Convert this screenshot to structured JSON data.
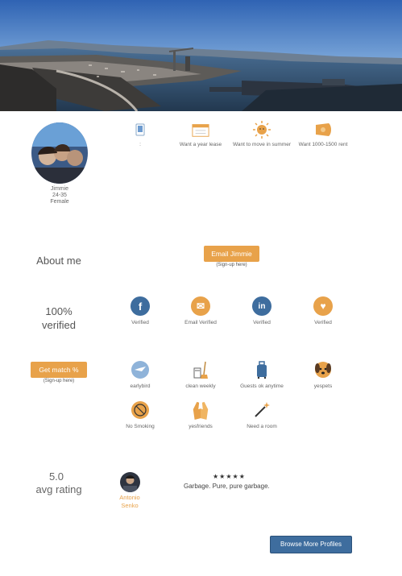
{
  "profile": {
    "name": "Jimmie",
    "age_range": "24-35",
    "gender": "Female"
  },
  "preferences": [
    {
      "icon": "phone-icon",
      "label": ":"
    },
    {
      "icon": "calendar-icon",
      "label": "Want a year lease"
    },
    {
      "icon": "sun-icon",
      "label": "Want to move in summer"
    },
    {
      "icon": "money-icon",
      "label": "Want 1000-1500 rent"
    }
  ],
  "about": {
    "heading": "About me",
    "email_button": "Email Jimmie",
    "signup_note": "(Sign-up here)"
  },
  "verification": {
    "heading_line1": "100%",
    "heading_line2": "verified",
    "badges": [
      {
        "icon": "facebook-icon",
        "label": "Verified",
        "color": "#3e6d9e",
        "glyph": "f"
      },
      {
        "icon": "email-icon",
        "label": "Email Verified",
        "color": "#e8a24a",
        "glyph": "✉"
      },
      {
        "icon": "linkedin-icon",
        "label": "Verified",
        "color": "#3e6d9e",
        "glyph": "in"
      },
      {
        "icon": "heart-icon",
        "label": "Verified",
        "color": "#e8a24a",
        "glyph": "♥"
      }
    ]
  },
  "match": {
    "button": "Get match %",
    "signup_note": "(Sign-up here)"
  },
  "traits": [
    {
      "icon": "bird-icon",
      "label": "earlybird"
    },
    {
      "icon": "broom-icon",
      "label": "clean weekly"
    },
    {
      "icon": "luggage-icon",
      "label": "Guests ok anytime"
    },
    {
      "icon": "dog-icon",
      "label": "yespets"
    },
    {
      "icon": "no-smoking-icon",
      "label": "No Smoking"
    },
    {
      "icon": "high-five-icon",
      "label": "yesfriends"
    },
    {
      "icon": "magic-wand-icon",
      "label": "Need a room"
    }
  ],
  "rating": {
    "score": "5.0",
    "label": "avg rating",
    "reviewer_first": "Antonio",
    "reviewer_last": "Senko",
    "stars": "★★★★★",
    "review": "Garbage. Pure, pure garbage."
  },
  "footer": {
    "browse_button": "Browse More Profiles"
  },
  "colors": {
    "accent": "#e8a24a",
    "brand_blue": "#3e6d9e"
  }
}
